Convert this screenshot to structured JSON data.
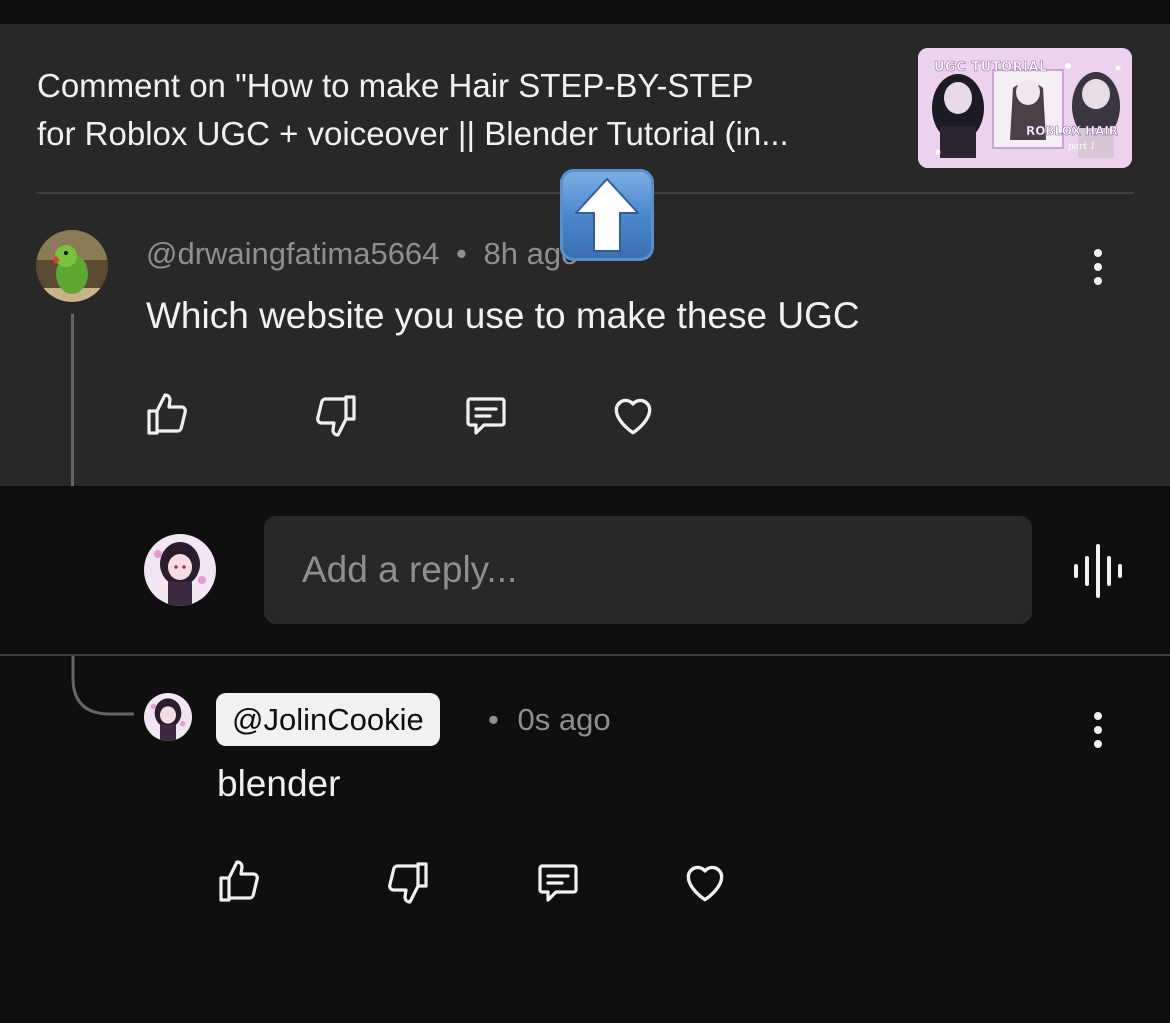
{
  "header": {
    "title_line1": "Comment on \"How to make Hair STEP-BY-STEP",
    "title_line2": "for Roblox UGC + voiceover || Blender Tutorial (in...",
    "thumbnail": {
      "top_label": "UGC TUTORIAL",
      "right_label": "ROBLOX HAIR",
      "corner_label": "part 1"
    }
  },
  "comment": {
    "author": "@drwaingfatima5664",
    "separator": "•",
    "time": "8h ago",
    "text": "Which website you use to make these UGC",
    "actions": [
      "like-icon",
      "dislike-icon",
      "reply-icon",
      "heart-icon"
    ]
  },
  "reply_box": {
    "placeholder": "Add a reply...",
    "mic_icon": "voice-wave-icon"
  },
  "reply": {
    "author": "@JolinCookie",
    "separator": "•",
    "time": "0s ago",
    "text": "blender",
    "actions": [
      "like-icon",
      "dislike-icon",
      "reply-icon",
      "heart-icon"
    ]
  },
  "overlay": {
    "icon": "up-arrow-emoji-icon"
  },
  "colors": {
    "panel": "#282828",
    "background": "#0f0f0f",
    "muted": "#8f8f8f",
    "text": "#f1f1f1"
  }
}
